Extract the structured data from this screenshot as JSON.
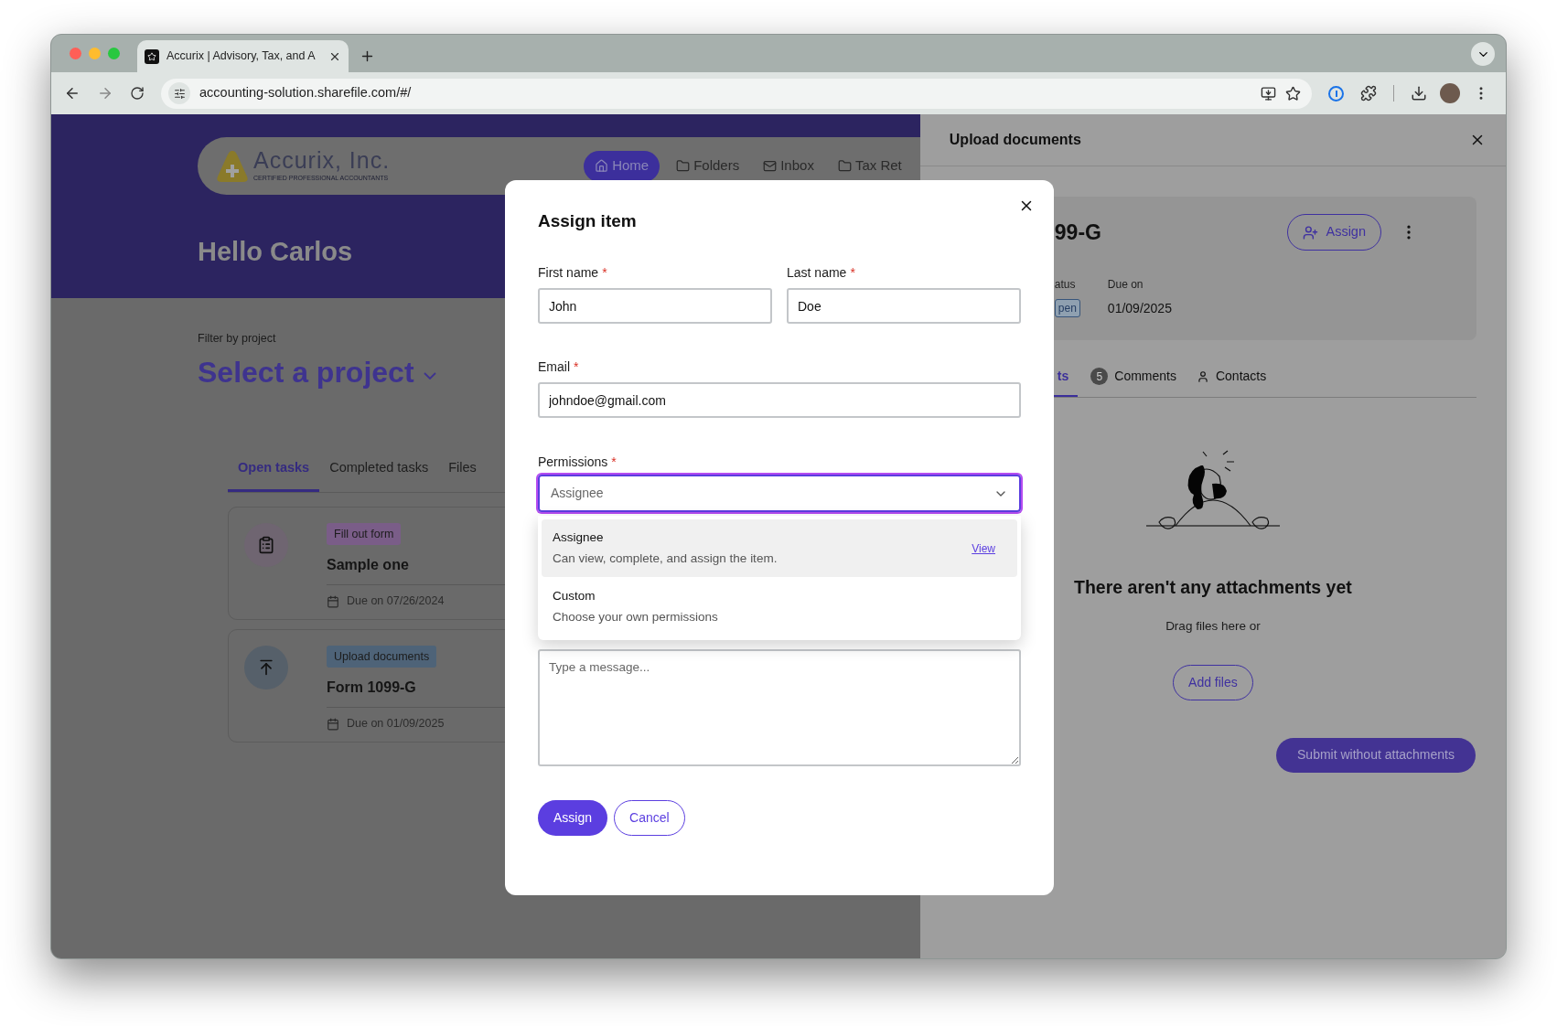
{
  "browser": {
    "tab_title": "Accurix | Advisory, Tax, and A",
    "url": "accounting-solution.sharefile.com/#/"
  },
  "header": {
    "logo_name": "Accurix, Inc.",
    "logo_tagline": "CERTIFIED PROFESSIONAL ACCOUNTANTS",
    "greeting": "Hello Carlos",
    "nav": [
      {
        "label": "Home",
        "selected": true
      },
      {
        "label": "Folders",
        "selected": false
      },
      {
        "label": "Inbox",
        "selected": false
      },
      {
        "label": "Tax Ret",
        "selected": false
      }
    ]
  },
  "filter": {
    "label": "Filter by project",
    "value": "Select a project"
  },
  "task_tabs": [
    {
      "label": "Open tasks",
      "selected": true
    },
    {
      "label": "Completed tasks",
      "selected": false
    },
    {
      "label": "Files",
      "selected": false
    }
  ],
  "tasks": [
    {
      "kind": "form",
      "badge": "Fill out form",
      "title": "Sample one",
      "due": "Due on 07/26/2024"
    },
    {
      "kind": "upload",
      "badge": "Upload documents",
      "title": "Form 1099-G",
      "due": "Due on 01/09/2025"
    }
  ],
  "panel": {
    "title": "Upload documents",
    "item_title": "99-G",
    "assign_button": "Assign",
    "status_label": "atus",
    "status": "pen",
    "due_label": "Due on",
    "due": "01/09/2025",
    "tabs": [
      {
        "label": "ts",
        "selected": true
      },
      {
        "label": "Comments",
        "count": "5",
        "selected": false
      },
      {
        "label": "Contacts",
        "selected": false
      }
    ],
    "empty_title": "There aren't any attachments yet",
    "empty_text": "Drag files here or",
    "add_files": "Add files",
    "submit": "Submit without attachments"
  },
  "modal": {
    "title": "Assign item",
    "fields": [
      {
        "label": "First name",
        "required_mark": "*",
        "value": "John"
      },
      {
        "label": "Last name",
        "required_mark": "*",
        "value": "Doe"
      },
      {
        "label": "Email",
        "required_mark": "*",
        "value": "johndoe@gmail.com"
      }
    ],
    "permissions": {
      "label": "Permissions",
      "required_mark": "*",
      "placeholder": "Assignee",
      "expanded": true,
      "options": [
        {
          "name": "Assignee",
          "description": "Can view, complete, and assign the item.",
          "link": "View",
          "selected": true
        },
        {
          "name": "Custom",
          "description": "Choose your own permissions",
          "selected": false
        }
      ]
    },
    "message": {
      "placeholder": "Type a message..."
    },
    "buttons": [
      {
        "label": "Assign",
        "kind": "primary"
      },
      {
        "label": "Cancel",
        "kind": "secondary"
      }
    ]
  }
}
